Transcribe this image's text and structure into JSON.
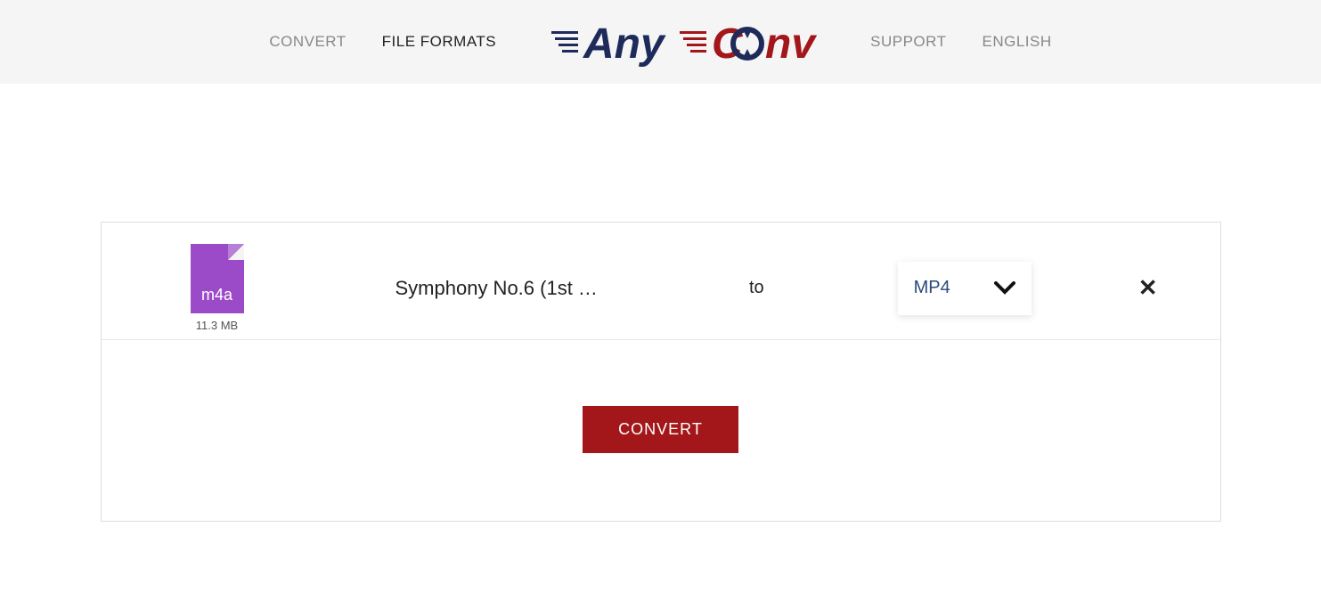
{
  "nav": {
    "convert": "CONVERT",
    "file_formats": "FILE FORMATS",
    "support": "SUPPORT",
    "english": "ENGLISH"
  },
  "logo": {
    "text_any": "Any",
    "text_c": "C",
    "text_nv": "nv"
  },
  "file": {
    "ext": "m4a",
    "size": "11.3 MB",
    "name": "Symphony No.6 (1st …",
    "to_label": "to",
    "target_format": "MP4"
  },
  "buttons": {
    "convert": "CONVERT"
  },
  "colors": {
    "brand_red": "#a3171b",
    "brand_navy": "#1e2a5a",
    "file_purple": "#9b4bc7"
  }
}
